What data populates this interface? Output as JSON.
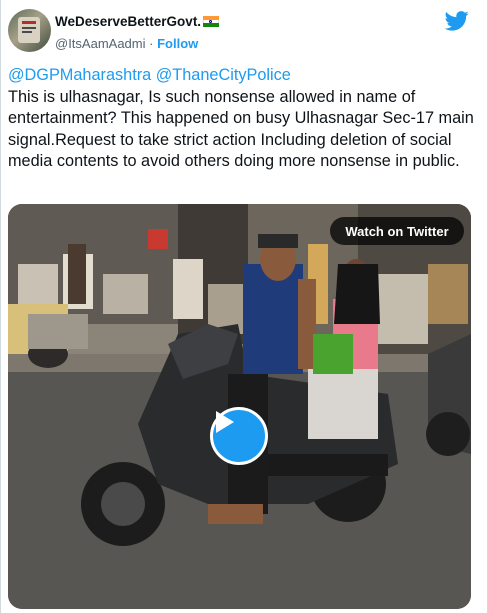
{
  "tweet": {
    "author": {
      "display_name": "WeDeserveBetterGovt.",
      "handle": "@ItsAamAadmi",
      "separator": "·",
      "follow_label": "Follow",
      "flag_icon": "india-flag-icon",
      "avatar_icon": "avatar"
    },
    "brand_icon": "twitter-bird-icon",
    "text": {
      "mention1": "@DGPMaharashtra",
      "mention2": "@ThaneCityPolice",
      "body": "This is ulhasnagar, Is such nonsense allowed in name of entertainment? This happened on busy Ulhasnagar Sec-17 main signal.Request to take strict action Including deletion of social media contents to avoid others doing more nonsense in public."
    },
    "media": {
      "watch_label": "Watch on Twitter",
      "play_icon": "play-icon"
    }
  },
  "colors": {
    "link": "#1d9bf0",
    "text": "#0f1419",
    "secondary": "#536471",
    "play_button": "#1d9bf0"
  }
}
